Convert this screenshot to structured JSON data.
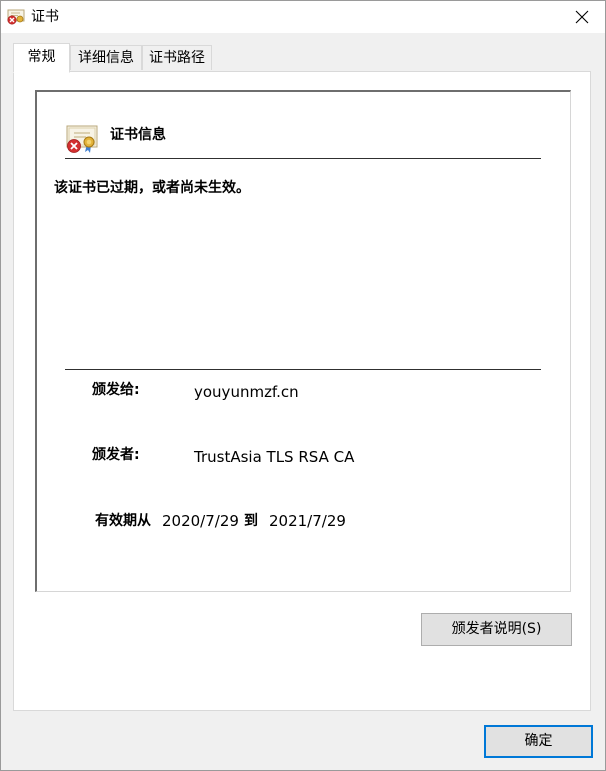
{
  "window": {
    "title": "证书",
    "title_icon": "certificate-error-icon",
    "close_icon": "close-icon"
  },
  "tabs": [
    {
      "label": "常规",
      "active": true
    },
    {
      "label": "详细信息",
      "active": false
    },
    {
      "label": "证书路径",
      "active": false
    }
  ],
  "certificate": {
    "heading": "证书信息",
    "heading_icon": "certificate-invalid-icon",
    "status": "该证书已过期，或者尚未生效。",
    "issued_to_label": "颁发给:",
    "issued_to_value": "youyunmzf.cn",
    "issued_by_label": "颁发者:",
    "issued_by_value": "TrustAsia TLS RSA CA",
    "valid_from_label": "有效期从",
    "valid_from_value": "2020/7/29",
    "valid_to_label": "到",
    "valid_to_value": "2021/7/29"
  },
  "buttons": {
    "issuer_statement": "颁发者说明(S)",
    "ok": "确定"
  },
  "colors": {
    "accent": "#0078d7",
    "error": "#d32f2f"
  }
}
